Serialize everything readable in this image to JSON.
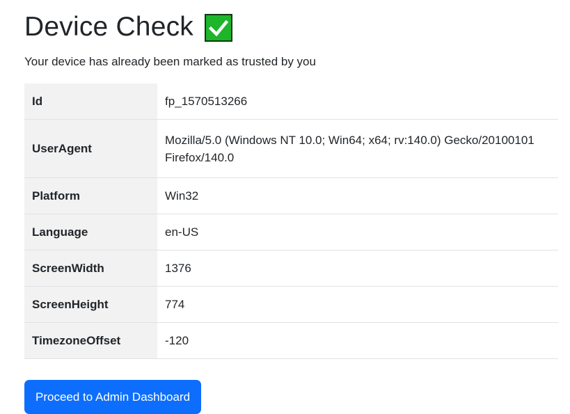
{
  "header": {
    "title": "Device Check",
    "icon": "check-mark-icon",
    "icon_color": "#1db52a",
    "subtitle": "Your device has already been marked as trusted by you"
  },
  "device_info": {
    "rows": [
      {
        "key": "Id",
        "value": "fp_1570513266"
      },
      {
        "key": "UserAgent",
        "value": "Mozilla/5.0 (Windows NT 10.0; Win64; x64; rv:140.0) Gecko/20100101 Firefox/140.0"
      },
      {
        "key": "Platform",
        "value": "Win32"
      },
      {
        "key": "Language",
        "value": "en-US"
      },
      {
        "key": "ScreenWidth",
        "value": "1376"
      },
      {
        "key": "ScreenHeight",
        "value": "774"
      },
      {
        "key": "TimezoneOffset",
        "value": "-120"
      }
    ]
  },
  "actions": {
    "proceed_label": "Proceed to Admin Dashboard",
    "proceed_color": "#0d6efd"
  }
}
